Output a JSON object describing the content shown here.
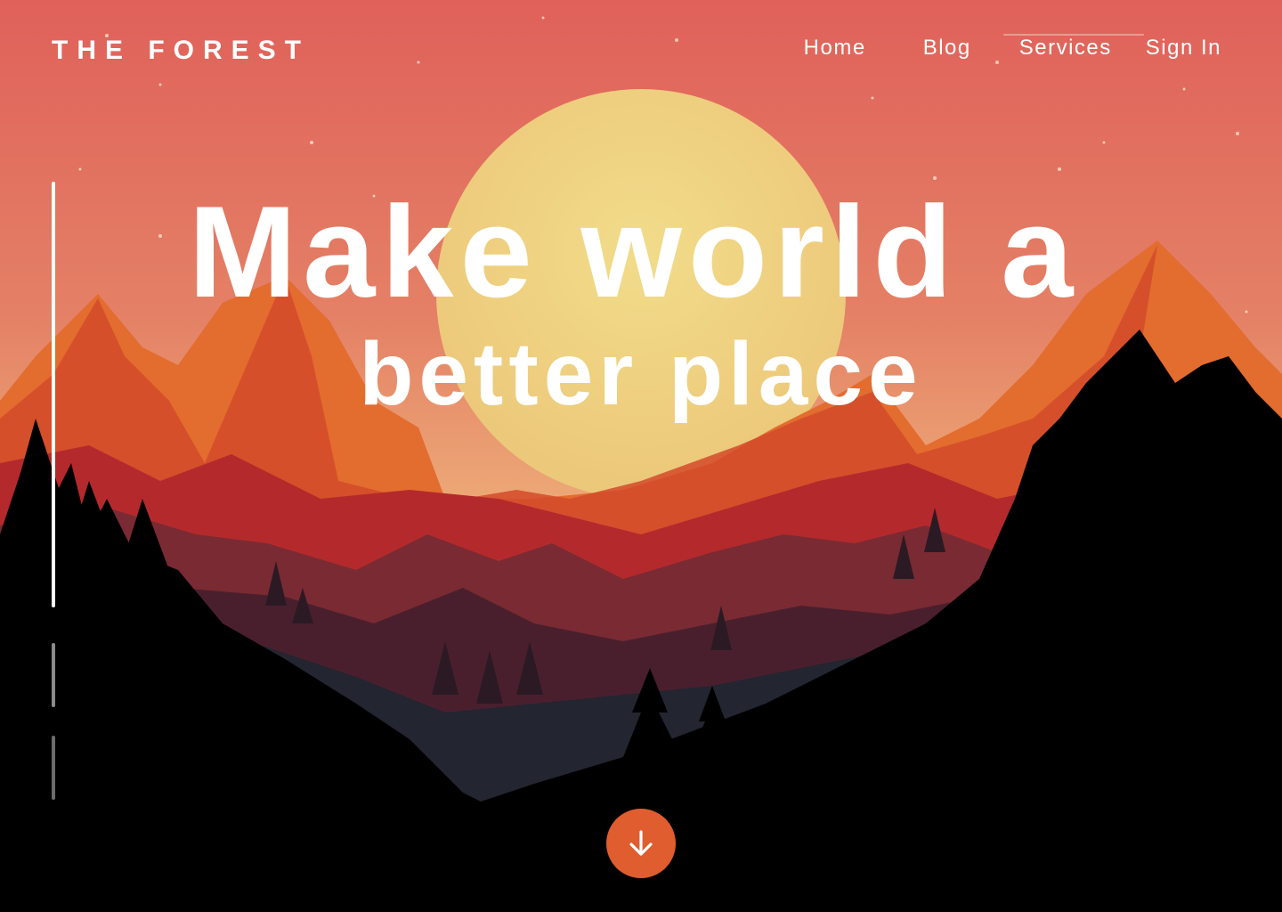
{
  "brand": "THE FOREST",
  "nav": {
    "items": [
      "Home",
      "Blog",
      "Services",
      "Sign In"
    ]
  },
  "hero": {
    "line1": "Make world a",
    "line2": "better place"
  },
  "slider": {
    "active_index": 0,
    "count": 3
  },
  "scroll_button": {
    "icon": "arrow-down-icon"
  },
  "colors": {
    "sky_top": "#e0605a",
    "sky_mid": "#e88a6a",
    "sun": "#ead27a",
    "mountain_light": "#e0682c",
    "mountain_dark": "#c0352a",
    "accent": "#df5d2e"
  }
}
